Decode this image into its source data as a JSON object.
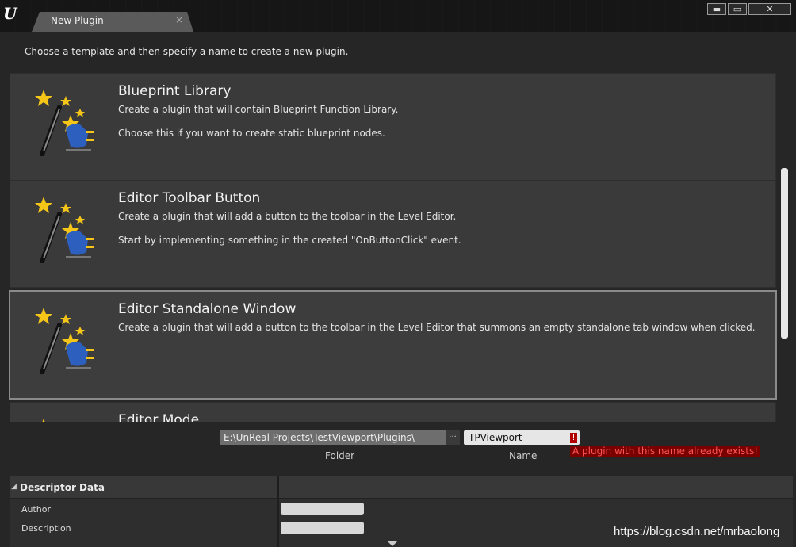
{
  "window": {
    "tab_label": "New Plugin",
    "tab_close": "×",
    "minimize": "▬",
    "maximize": "▭",
    "close": "✕"
  },
  "instructions": "Choose a template and then specify a name to create a new plugin.",
  "templates": [
    {
      "title": "Blueprint Library",
      "description": "Create a plugin that will contain Blueprint Function Library.",
      "detail": "Choose this if you want to create static blueprint nodes.",
      "selected": false
    },
    {
      "title": "Editor Toolbar Button",
      "description": "Create a plugin that will add a button to the toolbar in the Level Editor.",
      "detail": "Start by implementing something in the created \"OnButtonClick\" event.",
      "selected": false
    },
    {
      "title": "Editor Standalone Window",
      "description": "Create a plugin that will add a button to the toolbar in the Level Editor that summons an empty standalone tab window when clicked.",
      "detail": "",
      "selected": true
    },
    {
      "title": "Editor Mode",
      "description": "",
      "detail": "",
      "selected": false
    }
  ],
  "form": {
    "folder_value": "E:\\UnReal Projects\\TestViewport\\Plugins\\",
    "folder_browse": "···",
    "folder_caption": "Folder",
    "name_value": "TPViewport",
    "name_error_icon": "!",
    "name_caption": "Name",
    "error_message": "A plugin with this name already exists!"
  },
  "descriptor": {
    "header": "Descriptor Data",
    "collapse_arrow": "◢",
    "author_label": "Author",
    "author_value": "",
    "description_label": "Description",
    "description_value": ""
  },
  "watermark": "https://blog.csdn.net/mrbaolong",
  "colors": {
    "error": "#b00000",
    "selected_border": "#8a8a8a"
  }
}
